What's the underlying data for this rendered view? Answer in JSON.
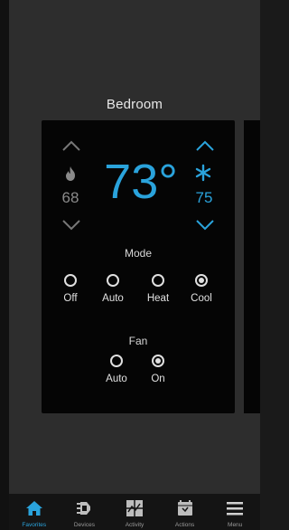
{
  "room": {
    "title": "Bedroom"
  },
  "thermostat": {
    "current_temp": "73°",
    "heat_setpoint": "68",
    "cool_setpoint": "75",
    "accent_color": "#2aa3dc"
  },
  "mode": {
    "label": "Mode",
    "options": [
      {
        "label": "Off",
        "selected": false
      },
      {
        "label": "Auto",
        "selected": false
      },
      {
        "label": "Heat",
        "selected": false
      },
      {
        "label": "Cool",
        "selected": true
      }
    ]
  },
  "fan": {
    "label": "Fan",
    "options": [
      {
        "label": "Auto",
        "selected": false
      },
      {
        "label": "On",
        "selected": true
      }
    ]
  },
  "nav": {
    "items": [
      {
        "label": "Favorites",
        "icon": "home-icon",
        "active": true
      },
      {
        "label": "Devices",
        "icon": "plug-icon",
        "active": false
      },
      {
        "label": "Activity",
        "icon": "activity-icon",
        "active": false
      },
      {
        "label": "Actions",
        "icon": "clock-icon",
        "active": false
      },
      {
        "label": "Menu",
        "icon": "menu-icon",
        "active": false
      }
    ]
  }
}
